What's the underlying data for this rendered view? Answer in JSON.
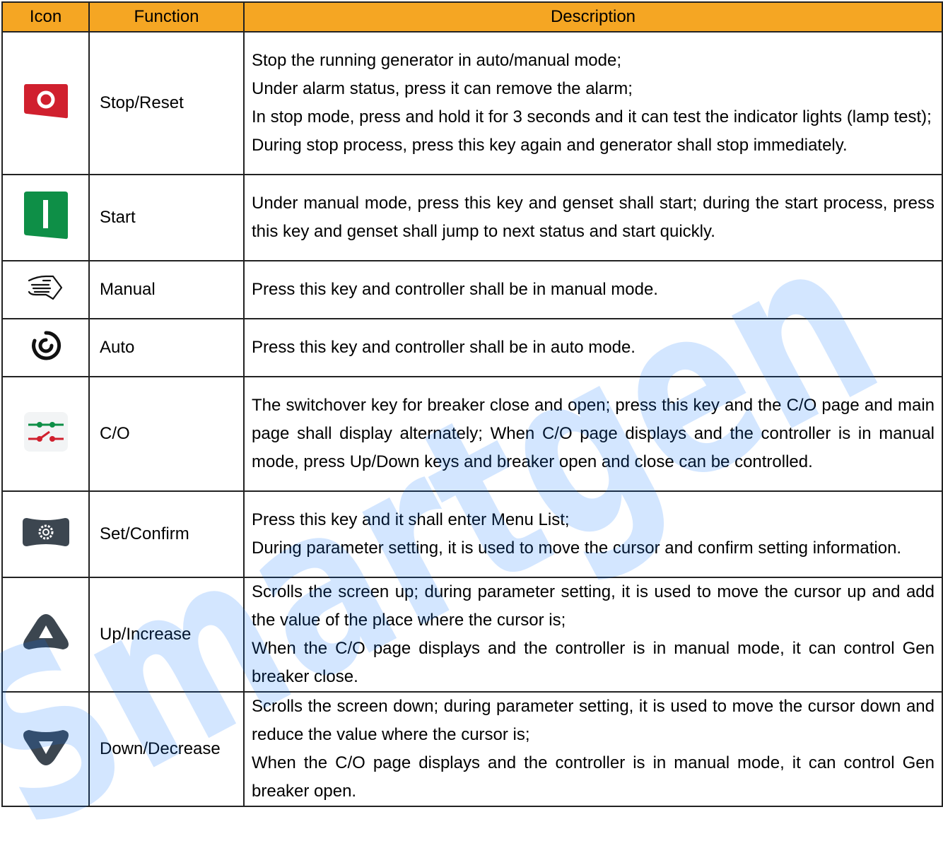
{
  "headers": {
    "icon": "Icon",
    "function": "Function",
    "description": "Description"
  },
  "rows": [
    {
      "icon": "stop-reset-icon",
      "function": "Stop/Reset",
      "lines": [
        "Stop the running generator in auto/manual mode;",
        "Under alarm status, press it can remove the alarm;",
        "In stop mode, press and hold it for 3 seconds and it can test the indicator lights (lamp test);",
        "During stop process, press this key again and generator shall stop immediately."
      ]
    },
    {
      "icon": "start-icon",
      "function": "Start",
      "lines": [
        "Under manual mode, press this key and genset shall start; during the start process, press this key and genset shall jump to next status and start quickly."
      ]
    },
    {
      "icon": "manual-hand-icon",
      "function": "Manual",
      "lines": [
        "Press this key and controller shall be in manual mode."
      ]
    },
    {
      "icon": "auto-icon",
      "function": "Auto",
      "lines": [
        "Press this key and controller shall be in auto mode."
      ]
    },
    {
      "icon": "changeover-breaker-icon",
      "function": "C/O",
      "lines": [
        "The switchover key for breaker close and open; press this key and the C/O page and main page shall display alternately; When C/O page displays and the controller is in manual mode, press Up/Down keys and breaker open and close can be controlled."
      ]
    },
    {
      "icon": "set-confirm-gear-icon",
      "function": "Set/Confirm",
      "lines": [
        "Press this key and it shall enter Menu List;",
        "During parameter setting, it is used to move the cursor and confirm setting information."
      ]
    },
    {
      "icon": "up-arrow-icon",
      "function": "Up/Increase",
      "lines": [
        "Scrolls the screen up; during parameter setting, it is used to move the cursor up and add the value of the place where the cursor is;",
        "When the C/O page displays and the controller is in manual mode, it can control Gen breaker close."
      ]
    },
    {
      "icon": "down-arrow-icon",
      "function": "Down/Decrease",
      "lines": [
        "Scrolls the screen down; during parameter setting, it is used to move the cursor down and reduce the value where the cursor is;",
        "When the C/O page displays and the controller is in manual mode, it can control Gen breaker open."
      ]
    }
  ],
  "watermark": "Smartgen",
  "colors": {
    "header_bg": "#f5a623",
    "stop_red": "#d0202e",
    "start_green": "#0e8f47",
    "key_dark": "#3c4650",
    "watermark_blue": "#0b76ff"
  }
}
